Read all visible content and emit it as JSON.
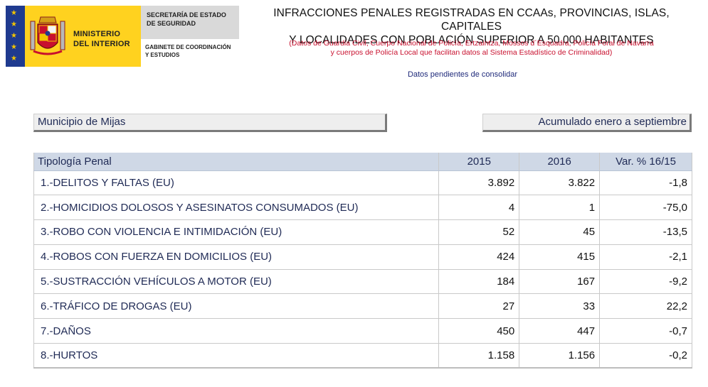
{
  "header": {
    "ministry_line1": "MINISTERIO",
    "ministry_line2": "DEL INTERIOR",
    "secretaria_line1": "SECRETARÍA DE ESTADO",
    "secretaria_line2": "DE SEGURIDAD",
    "gabinete_line1": "GABINETE DE COORDINACIÓN",
    "gabinete_line2": "Y ESTUDIOS",
    "title_line1": "INFRACCIONES PENALES REGISTRADAS EN CCAAs, PROVINCIAS, ISLAS, CAPITALES",
    "title_line2": "Y LOCALIDADES CON POBLACIÓN SUPERIOR A 50.000 HABITANTES",
    "subtitle_line1": "(Datos de Guardia Civil, Cuerpo Nacional de Policía, Ertzaintza, Mossos d´Esquadra, Policía Foral de Navarra",
    "subtitle_line2": "y cuerpos de Policía Local que facilitan datos al Sistema Estadístico de Criminalidad)",
    "pending_note": "Datos pendientes de consolidar",
    "colors": {
      "eu_blue": "#1f3a8f",
      "ministry_yellow": "#ffd21f",
      "subtitle_red": "#c8102e"
    },
    "icons": {
      "flag": "eu-flag-icon",
      "crest": "spain-coat-of-arms-icon"
    }
  },
  "selectors": {
    "municipality": "Municipio de Mijas",
    "period": "Acumulado enero a septiembre"
  },
  "table": {
    "headers": [
      "Tipología Penal",
      "2015",
      "2016",
      "Var. % 16/15"
    ],
    "rows": [
      [
        "1.-DELITOS Y FALTAS (EU)",
        "3.892",
        "3.822",
        "-1,8"
      ],
      [
        "2.-HOMICIDIOS DOLOSOS Y ASESINATOS CONSUMADOS (EU)",
        "4",
        "1",
        "-75,0"
      ],
      [
        "3.-ROBO CON VIOLENCIA E INTIMIDACIÓN (EU)",
        "52",
        "45",
        "-13,5"
      ],
      [
        "4.-ROBOS CON FUERZA EN DOMICILIOS (EU)",
        "424",
        "415",
        "-2,1"
      ],
      [
        "5.-SUSTRACCIÓN VEHÍCULOS A MOTOR (EU)",
        "184",
        "167",
        "-9,2"
      ],
      [
        "6.-TRÁFICO DE DROGAS (EU)",
        "27",
        "33",
        "22,2"
      ],
      [
        "7.-DAÑOS",
        "450",
        "447",
        "-0,7"
      ],
      [
        "8.-HURTOS",
        "1.158",
        "1.156",
        "-0,2"
      ]
    ]
  }
}
